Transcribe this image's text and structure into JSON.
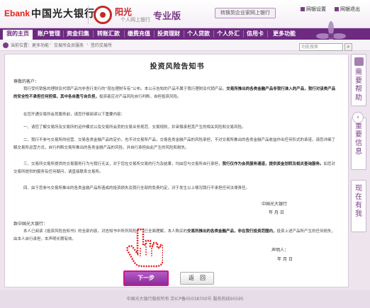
{
  "header": {
    "logo_text": "Ebank",
    "bank_name": "中国光大银行",
    "sun_title": "阳光",
    "sun_subtitle": "个人网上银行",
    "edition": "专业版",
    "enterprise_link": "转换到企业家网上银行",
    "settings_link": "网银设置",
    "logout_link": "网银退出"
  },
  "nav": {
    "items": [
      {
        "label": "我的主页",
        "active": true
      },
      {
        "label": "账户管理",
        "active": false
      },
      {
        "label": "资金归集",
        "active": false
      },
      {
        "label": "转账汇款",
        "active": false
      },
      {
        "label": "缴费充值",
        "active": false
      },
      {
        "label": "投资理财",
        "active": false
      },
      {
        "label": "个人贷款",
        "active": false
      },
      {
        "label": "个人外汇",
        "active": false
      },
      {
        "label": "信用卡",
        "active": false
      },
      {
        "label": "更多功能",
        "active": false
      }
    ]
  },
  "breadcrumb": {
    "items": [
      "当前位置：更多功能",
      "交易所会员服务",
      "签约交易所"
    ]
  },
  "search": {
    "placeholder": "功能搜索",
    "button_icon": "search-icon"
  },
  "document": {
    "title": "投资风险告知书",
    "salutation": "尊敬的客户：",
    "para1_normal": "我行受托销售的理财及代销产品均非吾行发行的“现在理财专有”公布。本公示告知的产品不属于我行理财及代销产品，",
    "para1_bold": "交易所推出的各类金融产品非我行准入的产品，我行对该类产品的安全性不承担任何担保，其中各自盈亏自负担，",
    "para1_end": "投资者应对产品风险自行判断，自担投资风险。",
    "para2": "在您开通交易所会员服务前，请您仔细阅读以下重要内容：",
    "para3": "一、请您了解交易所及交易所的运作模式以及交易所会员的交易业务规范、交易规则，并审慎承担其产生的相关风险和交易风险。",
    "para4": "二、我行不参与交易所的经营、交易各类金融产品的定价，也不对交易所产品，交易各类金融产品的风险承担，不对交易所推出的各类金融产品收益作出任何形式的承诺，请您详细了解交易所运营方式，自行判断交易所推出的各类金融产品的风险，并自行承担由此产生的风险和损失。",
    "para5_normal": "三、交易所交易所提供的交易服务行为与我行无关，对于您在交易所交易的行为及结果，均由您与交易所自行承担，",
    "para5_bold": "我行仅作为会员服务通道，提供资金划转及相关查询服务。",
    "para5_end": "如您对交易所提供的服务有任何疑问，请直接联系交易所。",
    "para6": "四、由于您参与交易所推出的各类金融产品所造成的投资损失及我行全部的免责约定，对于发生以上情况我行不承担任何法律责任。",
    "bank_sign": "中国光大银行",
    "bank_date": "年  月  日",
    "ack_label": "致中国光大银行：",
    "ack_normal": "本人已阅读《投资风险告知书》的全部内容，对告知书中所列风险事项已全面理解，本人购买的",
    "ack_bold": "交易所推出的各类金融产品，非在我行投资范围内，",
    "ack_end": "投资上述产品所产生的任何损失，由本人自行承担，本声明长期有效。",
    "signer_label": "声明人：",
    "signer_date": "年  月  日"
  },
  "buttons": {
    "next": "下一步",
    "back": "返　回"
  },
  "side_panel": {
    "tabs": [
      "需要帮助",
      "重要信息",
      "现在有我"
    ]
  },
  "footer": {
    "text": "中国光大银行版权所有  京ICP备05038700号  服务热线95595"
  },
  "colors": {
    "brand_purple": "#6d2a80",
    "accent_red": "#c62828",
    "highlight_magenta": "#d1148b"
  }
}
